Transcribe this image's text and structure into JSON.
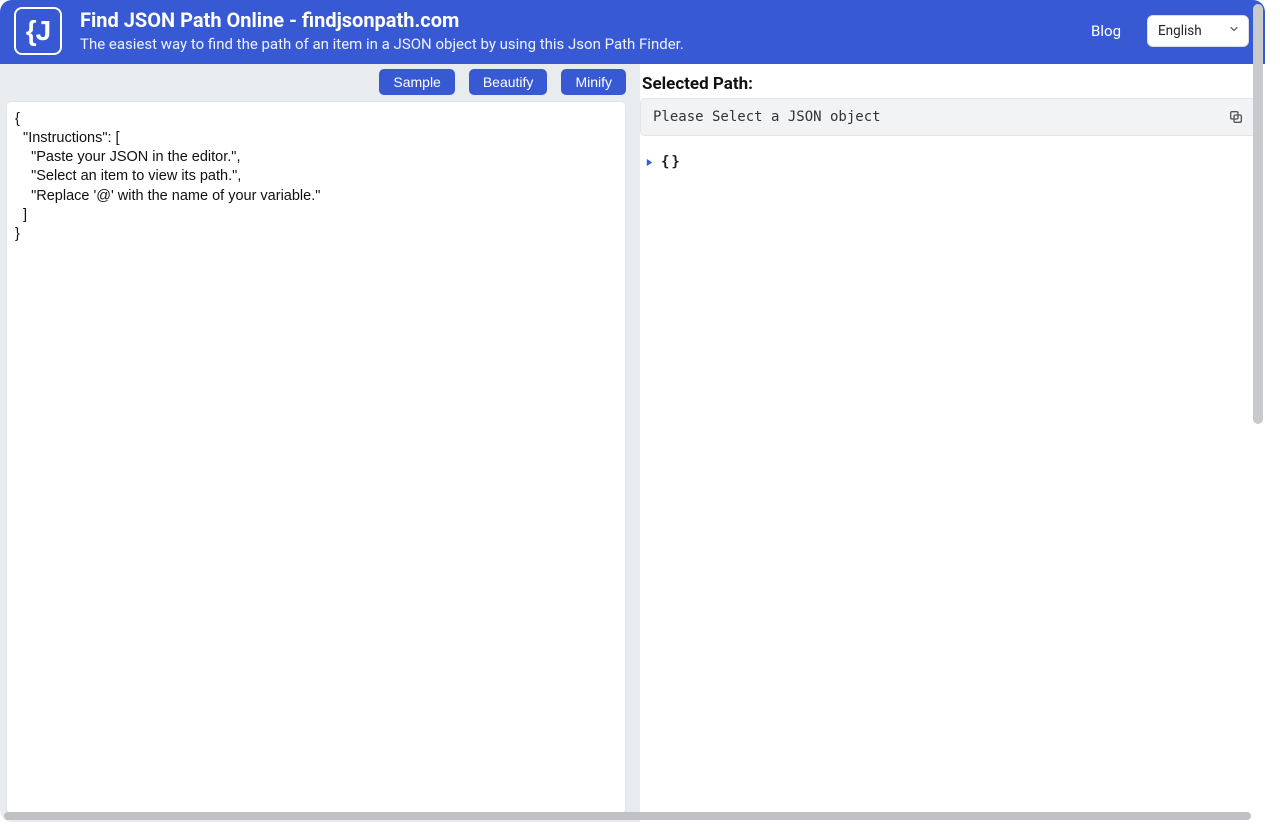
{
  "header": {
    "logo_text": "{J",
    "title": "Find JSON Path Online - findjsonpath.com",
    "subtitle": "The easiest way to find the path of an item in a JSON object by using this Json Path Finder.",
    "blog_label": "Blog",
    "language_selected": "English"
  },
  "toolbar": {
    "sample_label": "Sample",
    "beautify_label": "Beautify",
    "minify_label": "Minify"
  },
  "editor": {
    "content": "{\n  \"Instructions\": [\n    \"Paste your JSON in the editor.\",\n    \"Select an item to view its path.\",\n    \"Replace '@' with the name of your variable.\"\n  ]\n}"
  },
  "right_panel": {
    "selected_path_label": "Selected Path:",
    "path_placeholder": "Please Select a JSON object",
    "tree_root": "{}"
  },
  "icons": {
    "chevron_down": "chevron-down-icon",
    "copy": "copy-icon",
    "caret_right": "caret-right-icon",
    "logo": "json-logo-icon"
  },
  "colors": {
    "primary": "#3759d3",
    "panel_bg": "#f1f3f5",
    "border": "#e2e4e8"
  }
}
